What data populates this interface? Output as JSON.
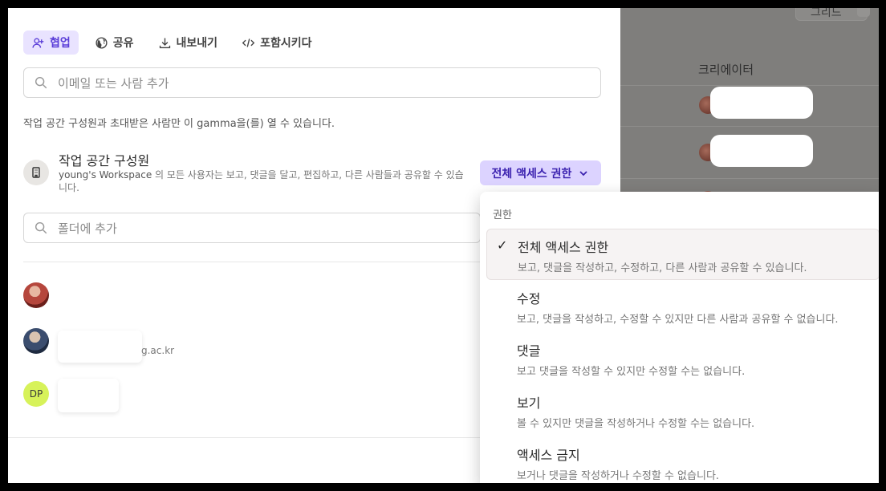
{
  "tabs": [
    {
      "label": "협업",
      "icon": "add-user-icon",
      "active": true
    },
    {
      "label": "공유",
      "icon": "globe-icon"
    },
    {
      "label": "내보내기",
      "icon": "download-icon"
    },
    {
      "label": "포함시키다",
      "icon": "code-icon"
    }
  ],
  "invite_search": {
    "placeholder": "이메일 또는 사람 추가"
  },
  "access_info": "작업 공간 구성원과 초대받은 사람만 이 gamma을(를) 열 수 있습니다.",
  "workspace": {
    "title": "작업 공간 구성원",
    "desc_name": "young's Workspace",
    "desc_rest": " 의 모든 사용자는 보고, 댓글을 달고, 편집하고, 다른 사람들과 공유할 수 있습니다.",
    "access_label": "전체 액세스 권한"
  },
  "folder_search": {
    "placeholder": "폴더에 추가"
  },
  "members": [
    {
      "initials": ""
    },
    {
      "initials": "",
      "email_fragment": "g.ac.kr"
    },
    {
      "initials": "DP"
    }
  ],
  "menu": {
    "header": "권한",
    "options": [
      {
        "title": "전체 액세스 권한",
        "desc": "보고, 댓글을 작성하고, 수정하고, 다른 사람과 공유할 수 있습니다.",
        "selected": true
      },
      {
        "title": "수정",
        "desc": "보고, 댓글을 작성하고, 수정할 수 있지만 다른 사람과 공유할 수 없습니다."
      },
      {
        "title": "댓글",
        "desc": "보고 댓글을 작성할 수 있지만 수정할 수는 없습니다."
      },
      {
        "title": "보기",
        "desc": "볼 수 있지만 댓글을 작성하거나 수정할 수는 없습니다."
      },
      {
        "title": "액세스 금지",
        "desc": "보거나 댓글을 작성하거나 수정할 수 없습니다."
      }
    ]
  },
  "background": {
    "column_header": "크리에이터",
    "top_button_label": "그리드"
  },
  "colors": {
    "accent": "#5a3dd8",
    "accent_bg": "#e9e3ff",
    "access_button_bg": "#dcd3ff",
    "backdrop": "#7f7e7c"
  }
}
